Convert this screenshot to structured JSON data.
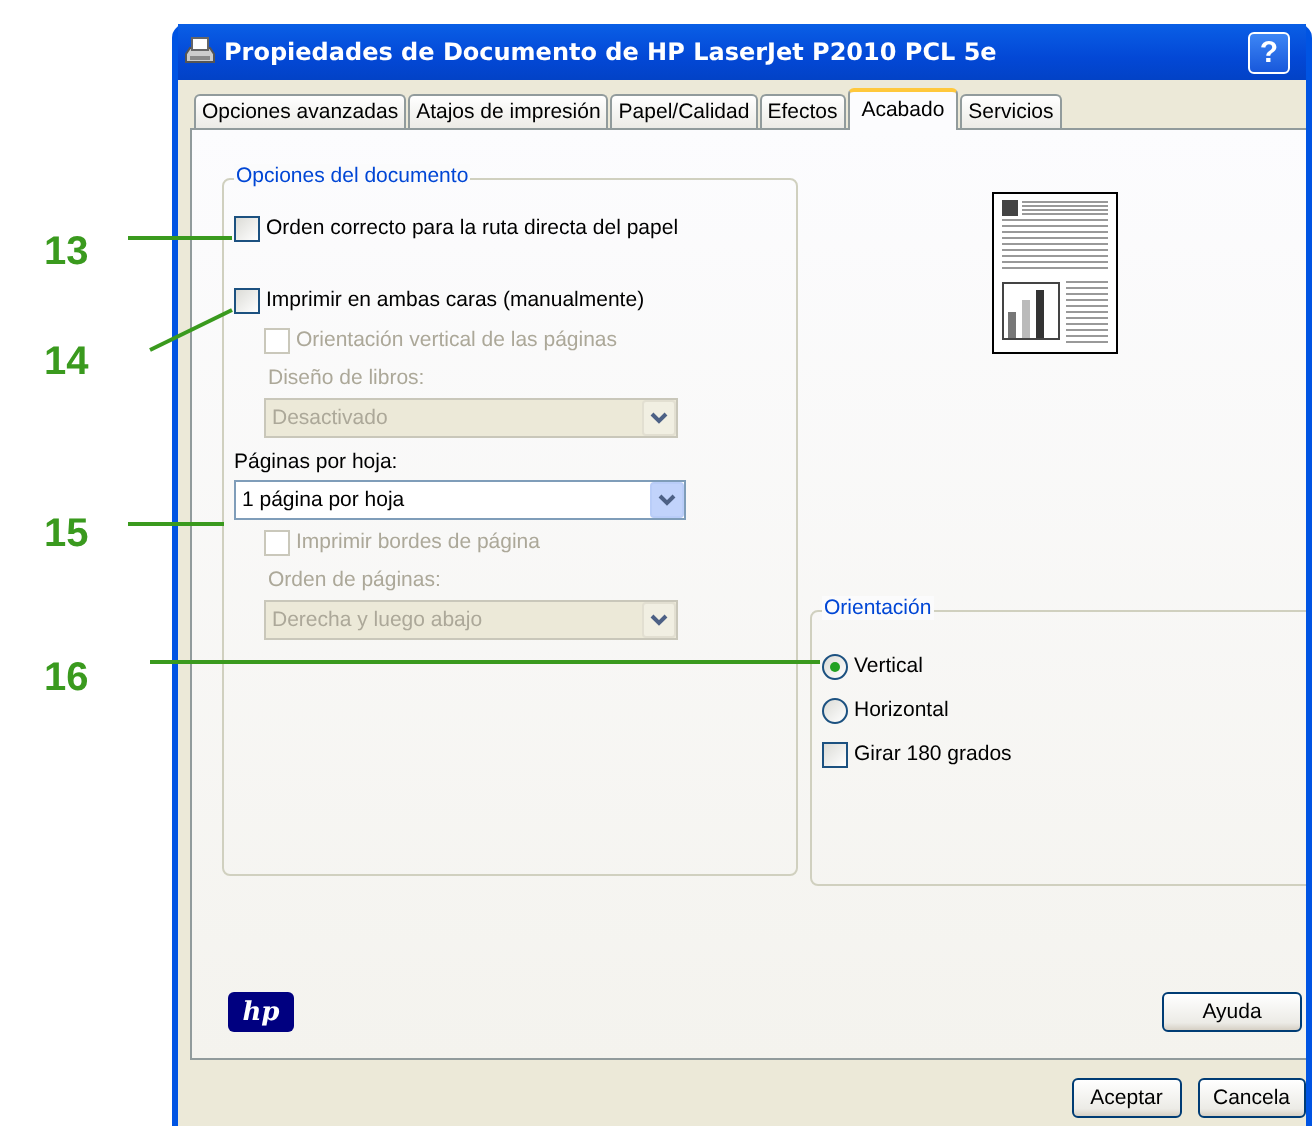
{
  "window": {
    "title": "Propiedades de Documento de HP LaserJet P2010 PCL 5e",
    "help_button": "?"
  },
  "tabs": [
    {
      "label": "Opciones avanzadas",
      "selected": false
    },
    {
      "label": "Atajos de impresión",
      "selected": false
    },
    {
      "label": "Papel/Calidad",
      "selected": false
    },
    {
      "label": "Efectos",
      "selected": false
    },
    {
      "label": "Acabado",
      "selected": true
    },
    {
      "label": "Servicios",
      "selected": false
    }
  ],
  "document_options": {
    "title": "Opciones del documento",
    "items": [
      {
        "kind": "checkbox",
        "label": "Orden correcto para la ruta directa del papel",
        "checked": false,
        "disabled": false
      },
      {
        "kind": "checkbox",
        "label": "Imprimir en ambas caras (manualmente)",
        "checked": false,
        "disabled": false,
        "children": [
          {
            "kind": "checkbox",
            "label": "Orientación vertical de las páginas",
            "checked": false,
            "disabled": true
          },
          {
            "kind": "label",
            "label": "Diseño de libros:",
            "disabled": true
          },
          {
            "kind": "dropdown",
            "value": "Desactivado",
            "disabled": true
          }
        ]
      },
      {
        "kind": "label",
        "label": "Páginas por hoja:",
        "disabled": false
      },
      {
        "kind": "dropdown",
        "value": "1 página por hoja",
        "disabled": false,
        "children": [
          {
            "kind": "checkbox",
            "label": "Imprimir bordes de página",
            "checked": false,
            "disabled": true
          },
          {
            "kind": "label",
            "label": "Orden de páginas:",
            "disabled": true
          },
          {
            "kind": "dropdown",
            "value": "Derecha y luego abajo",
            "disabled": true
          }
        ]
      }
    ]
  },
  "orientation": {
    "title": "Orientación",
    "items": [
      {
        "kind": "radio",
        "label": "Vertical",
        "selected": true
      },
      {
        "kind": "radio",
        "label": "Horizontal",
        "selected": false
      },
      {
        "kind": "checkbox",
        "label": "Girar 180 grados",
        "checked": false
      }
    ]
  },
  "logo": {
    "text": "hp"
  },
  "panel_buttons": [
    "Ayuda"
  ],
  "dialog_buttons": [
    "Aceptar",
    "Cancela"
  ],
  "callouts": [
    {
      "number": "13"
    },
    {
      "number": "14"
    },
    {
      "number": "15"
    },
    {
      "number": "16"
    }
  ]
}
